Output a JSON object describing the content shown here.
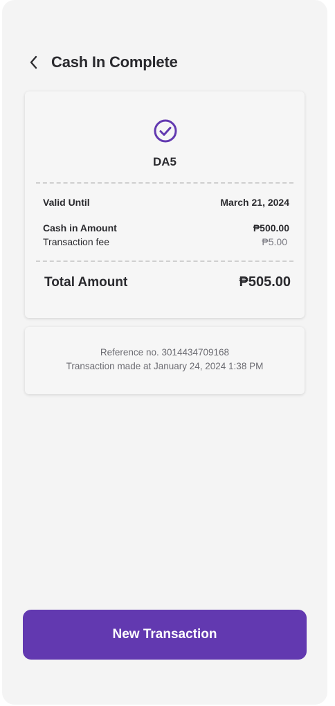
{
  "header": {
    "title": "Cash In Complete"
  },
  "summary": {
    "code": "DA5",
    "valid_until_label": "Valid Until",
    "valid_until_value": "March 21, 2024",
    "cash_in_label": "Cash in Amount",
    "cash_in_value": "₱500.00",
    "fee_label": "Transaction fee",
    "fee_value": "₱5.00",
    "total_label": "Total Amount",
    "total_value": "₱505.00"
  },
  "reference": {
    "ref_line": "Reference no. 3014434709168",
    "made_at_line": "Transaction made at January 24, 2024 1:38 PM"
  },
  "actions": {
    "new_transaction_label": "New Transaction"
  },
  "icons": {
    "back": "chevron-left-icon",
    "success": "check-circle-icon"
  },
  "colors": {
    "accent": "#6239b0",
    "background": "#f4f4f4",
    "card": "#f6f6f6"
  }
}
